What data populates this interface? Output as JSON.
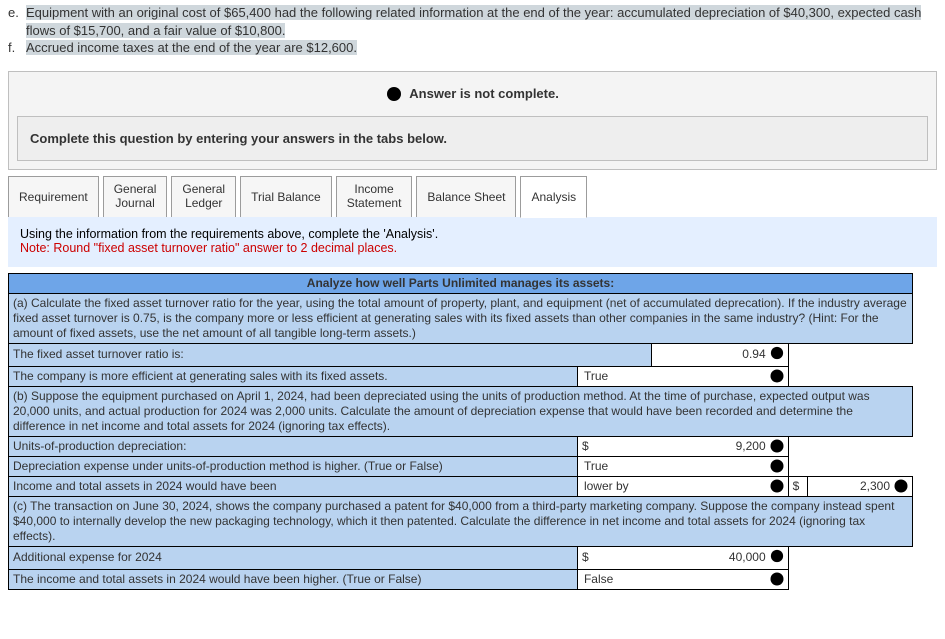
{
  "intro": {
    "e_marker": "e.",
    "e_text": "Equipment with an original cost of $65,400 had the following related information at the end of the year: accumulated depreciation of $40,300, expected cash flows of $15,700, and a fair value of $10,800.",
    "f_marker": "f.",
    "f_text": "Accrued income taxes at the end of the year are $12,600."
  },
  "status": "Answer is not complete.",
  "instruction": "Complete this question by entering your answers in the tabs below.",
  "tabs": [
    "Requirement",
    "General Journal",
    "General Ledger",
    "Trial Balance",
    "Income Statement",
    "Balance Sheet",
    "Analysis"
  ],
  "tab_content": {
    "line1": "Using the information from the requirements above, complete the 'Analysis'.",
    "line2": "Note: Round \"fixed asset turnover ratio\" answer to 2 decimal places."
  },
  "table": {
    "header": "Analyze how well Parts Unlimited manages its assets:",
    "a_text": "(a) Calculate the fixed asset turnover ratio for the year, using the total amount of property, plant, and equipment (net of accumulated deprecation). If the industry average fixed asset turnover is 0.75, is the company more or less efficient at generating sales with its fixed assets than other companies in the same industry? (Hint: For the amount of fixed assets, use the net amount of all tangible long-term assets.)",
    "a_r1_label": "The fixed asset turnover ratio is:",
    "a_r1_val": "0.94",
    "a_r2_label": "The company is more efficient at generating sales with its fixed assets.",
    "a_r2_val": "True",
    "b_text": "(b) Suppose the equipment purchased on April 1, 2024, had been depreciated using the units of production method. At the time of purchase, expected output was 20,000 units, and actual production for 2024 was 2,000 units. Calculate the amount of depreciation expense that would have been recorded and determine the difference in net income and total assets for 2024 (ignoring tax effects).",
    "b_r1_label": "Units-of-production depreciation:",
    "b_r1_cur": "$",
    "b_r1_val": "9,200",
    "b_r2_label": "Depreciation expense under units-of-production method is higher. (True or False)",
    "b_r2_val": "True",
    "b_r3_label": "Income and total assets in 2024 would have been",
    "b_r3_drop": "lower by",
    "b_r3_cur": "$",
    "b_r3_val": "2,300",
    "c_text": "(c) The transaction on June 30, 2024, shows the company purchased a patent for $40,000 from a third-party marketing company. Suppose the company instead spent $40,000 to internally develop the new packaging technology, which it then patented. Calculate the difference in net income and total assets for 2024 (ignoring tax effects).",
    "c_r1_label": "Additional expense for 2024",
    "c_r1_cur": "$",
    "c_r1_val": "40,000",
    "c_r2_label": "The income and total assets in 2024 would have been higher. (True or False)",
    "c_r2_val": "False"
  }
}
